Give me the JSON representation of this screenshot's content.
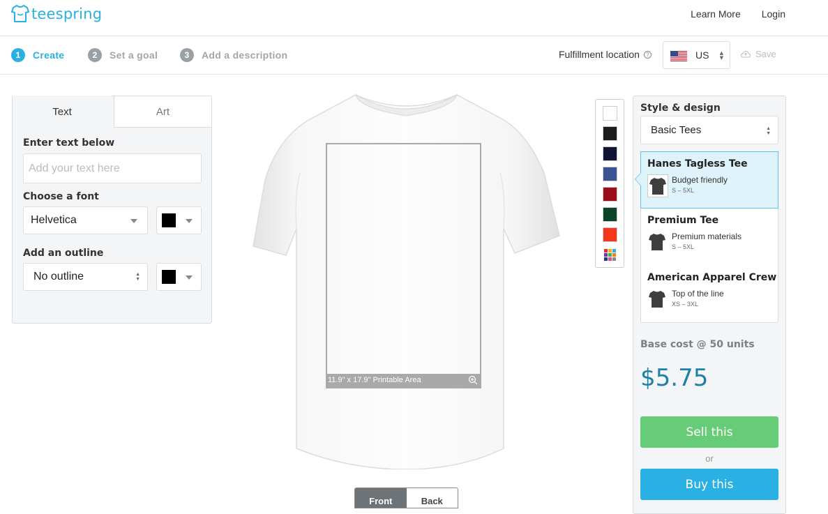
{
  "header": {
    "brand": "teespring",
    "nav": [
      {
        "label": "Learn More"
      },
      {
        "label": "Login"
      }
    ]
  },
  "steps": [
    {
      "num": "1",
      "label": "Create",
      "active": true
    },
    {
      "num": "2",
      "label": "Set a goal",
      "active": false
    },
    {
      "num": "3",
      "label": "Add a description",
      "active": false
    }
  ],
  "fulfillment": {
    "label": "Fulfillment location",
    "country": "US",
    "save_label": "Save"
  },
  "editor": {
    "tabs": [
      {
        "label": "Text"
      },
      {
        "label": "Art"
      }
    ],
    "text_label": "Enter text below",
    "text_placeholder": "Add your text here",
    "font_label": "Choose a font",
    "font_value": "Helvetica",
    "outline_label": "Add an outline",
    "outline_value": "No outline",
    "font_color": "#000000",
    "outline_color": "#000000"
  },
  "preview": {
    "printable_area": "11.9\" x 17.9\" Printable Area",
    "views": [
      {
        "label": "Front"
      },
      {
        "label": "Back"
      }
    ],
    "active_view": "Front"
  },
  "shirt_colors": [
    "#ffffff",
    "#1c1c1c",
    "#0d1436",
    "#3b5393",
    "#9d0d1b",
    "#0c4526",
    "#f4361b"
  ],
  "style_panel": {
    "title": "Style & design",
    "style_select": "Basic Tees",
    "products": [
      {
        "name": "Hanes Tagless Tee",
        "desc": "Budget friendly",
        "sizes": "S – 5XL",
        "selected": true
      },
      {
        "name": "Premium Tee",
        "desc": "Premium materials",
        "sizes": "S – 5XL",
        "selected": false
      },
      {
        "name": "American Apparel Crew",
        "desc": "Top of the line",
        "sizes": "XS – 3XL",
        "selected": false
      }
    ],
    "base_cost_label": "Base cost @ 50 units",
    "price": "$5.75",
    "sell_label": "Sell this",
    "or_label": "or",
    "buy_label": "Buy this"
  }
}
